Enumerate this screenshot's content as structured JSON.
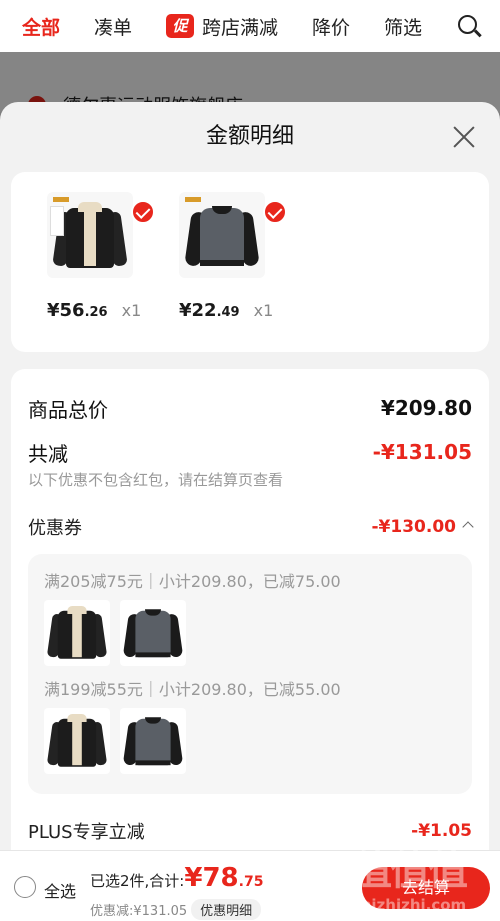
{
  "topnav": {
    "tabs": [
      {
        "label": "全部",
        "active": true
      },
      {
        "label": "凑单",
        "active": false
      },
      {
        "label": "跨店满减",
        "badge": "促",
        "active": false
      },
      {
        "label": "降价",
        "active": false
      },
      {
        "label": "筛选",
        "active": false
      }
    ]
  },
  "background": {
    "store_name": "德尔惠运动服饰旗舰店"
  },
  "sheet": {
    "title": "金额明细",
    "products": [
      {
        "price_int": "¥56",
        "price_dec": ".26",
        "qty": "x1",
        "icon": "jacket"
      },
      {
        "price_int": "¥22",
        "price_dec": ".49",
        "qty": "x1",
        "icon": "sweater"
      }
    ],
    "total_label": "商品总价",
    "total_value": "¥209.80",
    "reduce_label": "共减",
    "reduce_value": "-¥131.05",
    "reduce_note": "以下优惠不包含红包，请在结算页查看",
    "coupon_label": "优惠券",
    "coupon_value": "-¥130.00",
    "coupons": [
      {
        "line": "满205减75元｜小计209.80，已减75.00"
      },
      {
        "line": "满199减55元｜小计209.80，已减55.00"
      }
    ],
    "plus_label": "PLUS专享立减",
    "plus_value": "-¥1.05"
  },
  "bottom_bar": {
    "select_all": "全选",
    "selected_text": "已选2件,合计:",
    "total_int": "¥78",
    "total_dec": ".75",
    "savings": "优惠减:¥131.05",
    "detail_chip": "优惠明细",
    "checkout": "去结算"
  },
  "watermark": {
    "glyphs": "值值值",
    "site": "zhizhizhi.com"
  },
  "colors": {
    "accent": "#e8261c",
    "background": "#f2f2f2"
  }
}
